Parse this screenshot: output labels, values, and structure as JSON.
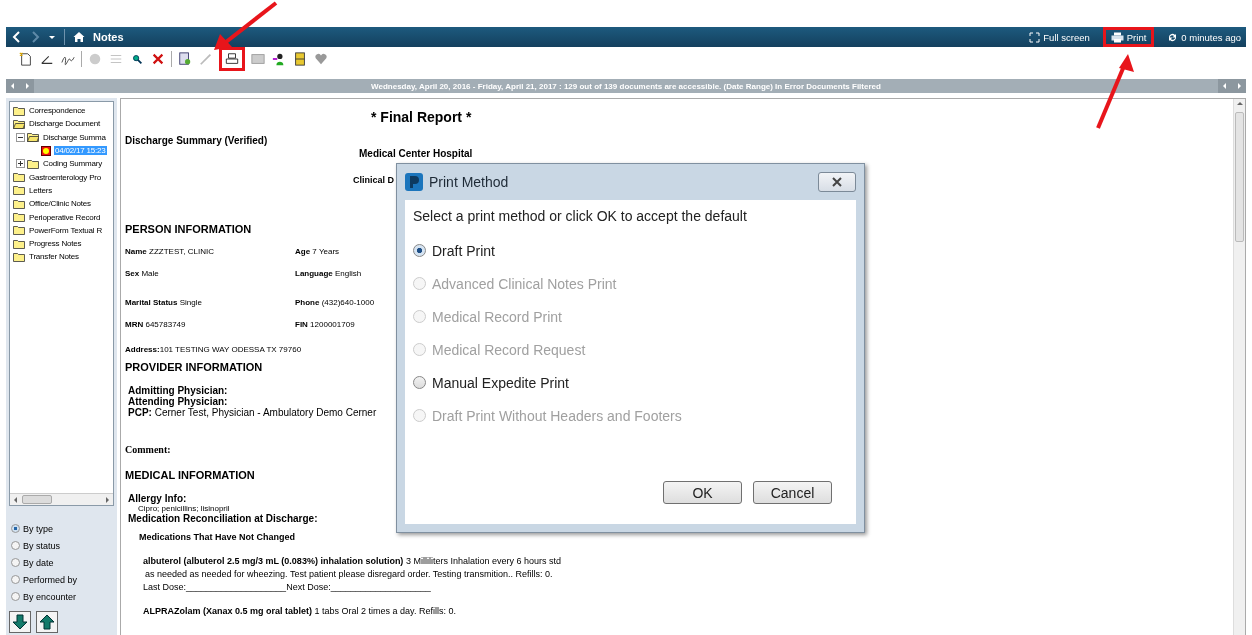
{
  "header": {
    "title": "Notes",
    "actions": [
      {
        "kind": "fullscreen",
        "label": "Full screen"
      },
      {
        "kind": "print",
        "label": "Print"
      },
      {
        "kind": "refresh",
        "label": "0 minutes ago"
      }
    ]
  },
  "date_bar": {
    "text": "Wednesday, April 20, 2016 - Friday, April 21, 2017 : 129 out of 139 documents are accessible. (Date Range)  In Error Documents Filtered"
  },
  "tree": [
    {
      "label": "Correspondence",
      "expanded": false
    },
    {
      "label": "Discharge Document",
      "expanded": true,
      "children": [
        {
          "label": "Discharge Summa",
          "expanded": true,
          "children": [
            {
              "label": "04/02/17 15:23",
              "kind": "document",
              "selected": true
            }
          ]
        },
        {
          "label": "Coding Summary",
          "expanded": false,
          "collapsible": true
        }
      ]
    },
    {
      "label": "Gastroenterology Pro",
      "expanded": false
    },
    {
      "label": "Letters",
      "expanded": false
    },
    {
      "label": "Office/Clinic Notes",
      "expanded": false
    },
    {
      "label": "Perioperative Record",
      "expanded": false
    },
    {
      "label": "PowerForm Textual R",
      "expanded": false
    },
    {
      "label": "Progress Notes",
      "expanded": false
    },
    {
      "label": "Transfer Notes",
      "expanded": false
    }
  ],
  "sort_options": [
    {
      "label": "By type",
      "selected": true
    },
    {
      "label": "By status",
      "selected": false
    },
    {
      "label": "By date",
      "selected": false
    },
    {
      "label": "Performed by",
      "selected": false
    },
    {
      "label": "By encounter",
      "selected": false
    }
  ],
  "document": {
    "title": "* Final Report *",
    "subtitle": "Discharge Summary (Verified)",
    "facility": "Medical Center Hospital",
    "clinical": "Clinical D",
    "person_heading": "PERSON INFORMATION",
    "person_fields": [
      [
        "**Name** ZZZTEST, CLINIC",
        "**Age**  7 Years"
      ],
      [
        "**Sex** Male",
        "**Language** English"
      ],
      [
        "**Marital Status** Single",
        "**Phone** (432)640-1000"
      ],
      [
        "**MRN** 645783749",
        "**FIN** 1200001709"
      ]
    ],
    "address": "**Address:**101 TESTING WAY ODESSA TX 79760",
    "provider_heading": "PROVIDER INFORMATION",
    "provider_lines": [
      "**Admitting Physician:**",
      "**Attending Physician:**",
      "**PCP:** Cerner Test, Physician - Ambulatory Demo Cerner"
    ],
    "comment": "Comment:",
    "medical_heading": "MEDICAL INFORMATION",
    "allergy_label": "Allergy Info:",
    "allergies": "Cipro; penicillins; lisinopril",
    "reconciliation": "Medication Reconciliation at Discharge:",
    "med_heading": "Medications That Have Not Changed",
    "med_lines": [
      {
        "kind": "med",
        "text": "**albuterol (albuterol 2.5 mg/3 mL (0.083%) inhalation solution)** 3 Milliliters Inhalation every 6 hours std"
      },
      {
        "kind": "cont",
        "text": "as needed as needed for wheezing. Test patient please disregard order. Testing transmition.. Refills: 0."
      },
      {
        "kind": "dose",
        "text": "Last Dose:____________________Next Dose:____________________"
      },
      {
        "kind": "med",
        "text": "**ALPRAZolam (Xanax 0.5 mg oral tablet)** 1 tabs Oral 2 times a day. Refills: 0."
      }
    ]
  },
  "dialog": {
    "title": "Print Method",
    "prompt": "Select a print method or click OK to accept the default",
    "options": [
      {
        "label": "Draft Print",
        "selected": true,
        "disabled": false
      },
      {
        "label": "Advanced Clinical Notes Print",
        "selected": false,
        "disabled": true
      },
      {
        "label": "Medical Record Print",
        "selected": false,
        "disabled": true
      },
      {
        "label": "Medical Record Request",
        "selected": false,
        "disabled": true
      },
      {
        "label": "Manual Expedite Print",
        "selected": false,
        "disabled": false
      },
      {
        "label": "Draft Print Without Headers and Footers",
        "selected": false,
        "disabled": true
      }
    ],
    "buttons": [
      "OK",
      "Cancel"
    ]
  }
}
